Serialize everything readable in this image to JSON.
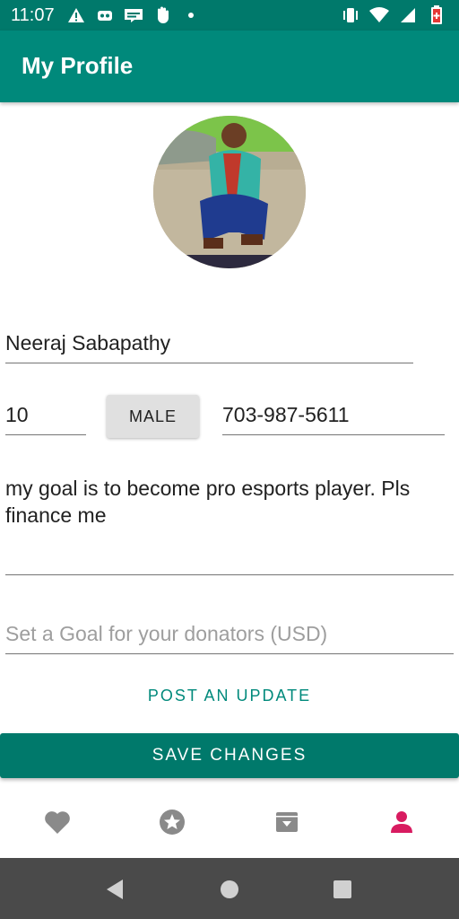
{
  "status_bar": {
    "time": "11:07",
    "left_icons": [
      "warning-icon",
      "game-controller-icon",
      "webtoon-icon",
      "hand-icon",
      "dot-icon"
    ],
    "right_icons": [
      "vibrate-icon",
      "wifi-icon",
      "cell-signal-icon",
      "battery-icon"
    ]
  },
  "app_bar": {
    "title": "My Profile"
  },
  "profile": {
    "avatar": "profile-photo",
    "name": "Neeraj Sabapathy",
    "age": "10",
    "gender_label": "MALE",
    "phone": "703-987-5611",
    "bio": "my goal is to become pro esports player. Pls finance me",
    "goal_placeholder": "Set a Goal for your donators (USD)"
  },
  "actions": {
    "post_update": "POST AN UPDATE",
    "save_changes": "SAVE CHANGES"
  },
  "bottom_nav": {
    "items": [
      "heart-icon",
      "star-icon",
      "archive-icon",
      "person-icon"
    ],
    "active_index": 3,
    "active_color": "#d81b60",
    "inactive_color": "#8a8a8a"
  },
  "colors": {
    "primary": "#00897b",
    "primary_dark": "#00796b"
  }
}
